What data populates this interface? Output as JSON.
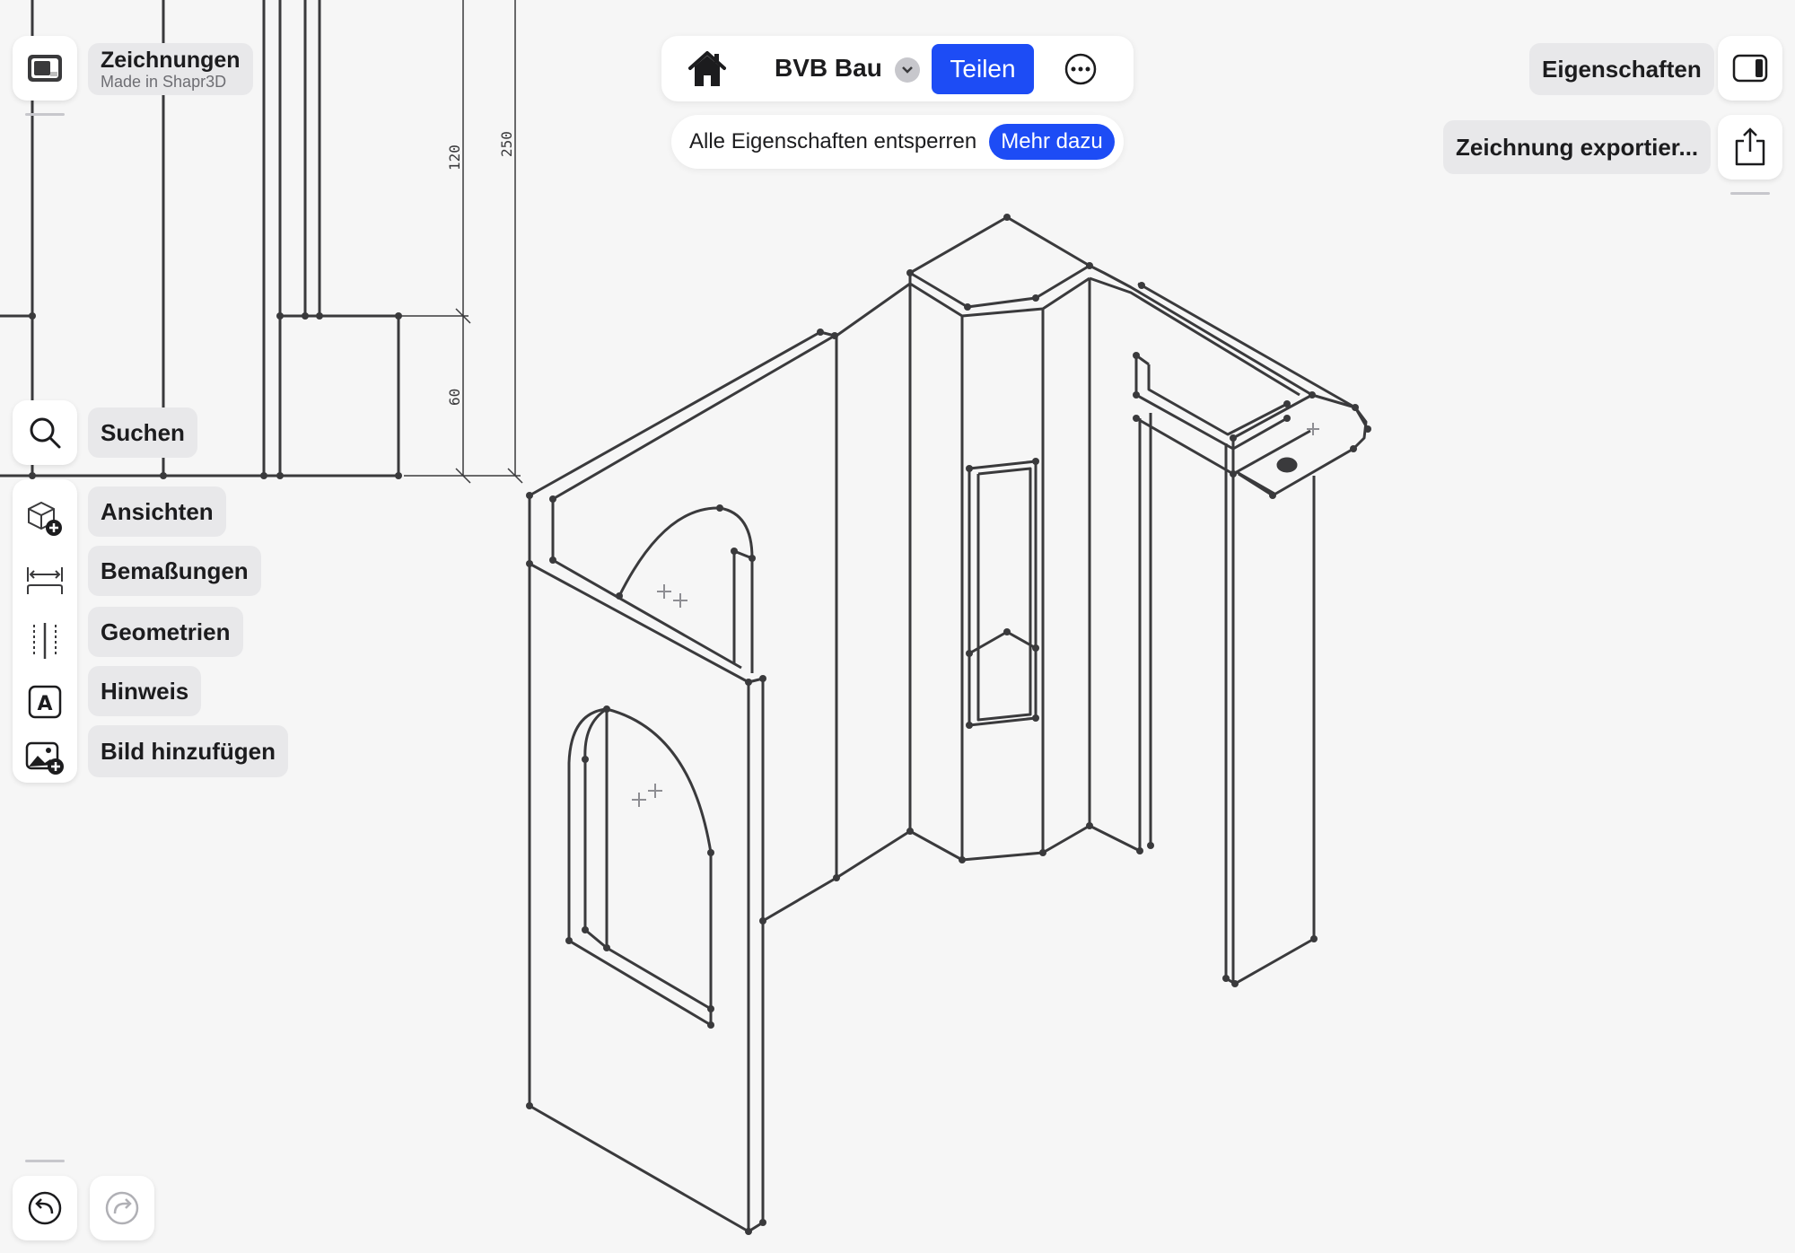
{
  "colors": {
    "accent": "#1d4cf5",
    "canvas_bg": "#f6f6f6",
    "line": "#3a3a3c",
    "pill_bg": "#e8e8ea"
  },
  "left_panel": {
    "drawings_title": "Zeichnungen",
    "drawings_subtitle": "Made in Shapr3D",
    "search_label": "Suchen",
    "tools": [
      {
        "label": "Ansichten",
        "icon": "views-cube-add-icon"
      },
      {
        "label": "Bemaßungen",
        "icon": "dimension-icon"
      },
      {
        "label": "Geometrien",
        "icon": "geometry-icon"
      },
      {
        "label": "Hinweis",
        "icon": "annotation-text-icon"
      },
      {
        "label": "Bild hinzufügen",
        "icon": "add-image-icon"
      }
    ]
  },
  "topbar": {
    "project_name": "BVB Bau",
    "share_label": "Teilen",
    "unlock_text": "Alle Eigenschaften entsperren",
    "learn_more_label": "Mehr dazu"
  },
  "right_panel": {
    "properties_label": "Eigenschaften",
    "export_label": "Zeichnung exportier..."
  },
  "drawing": {
    "dimension_upper": "120",
    "dimension_total": "250",
    "dimension_lower": "60"
  }
}
